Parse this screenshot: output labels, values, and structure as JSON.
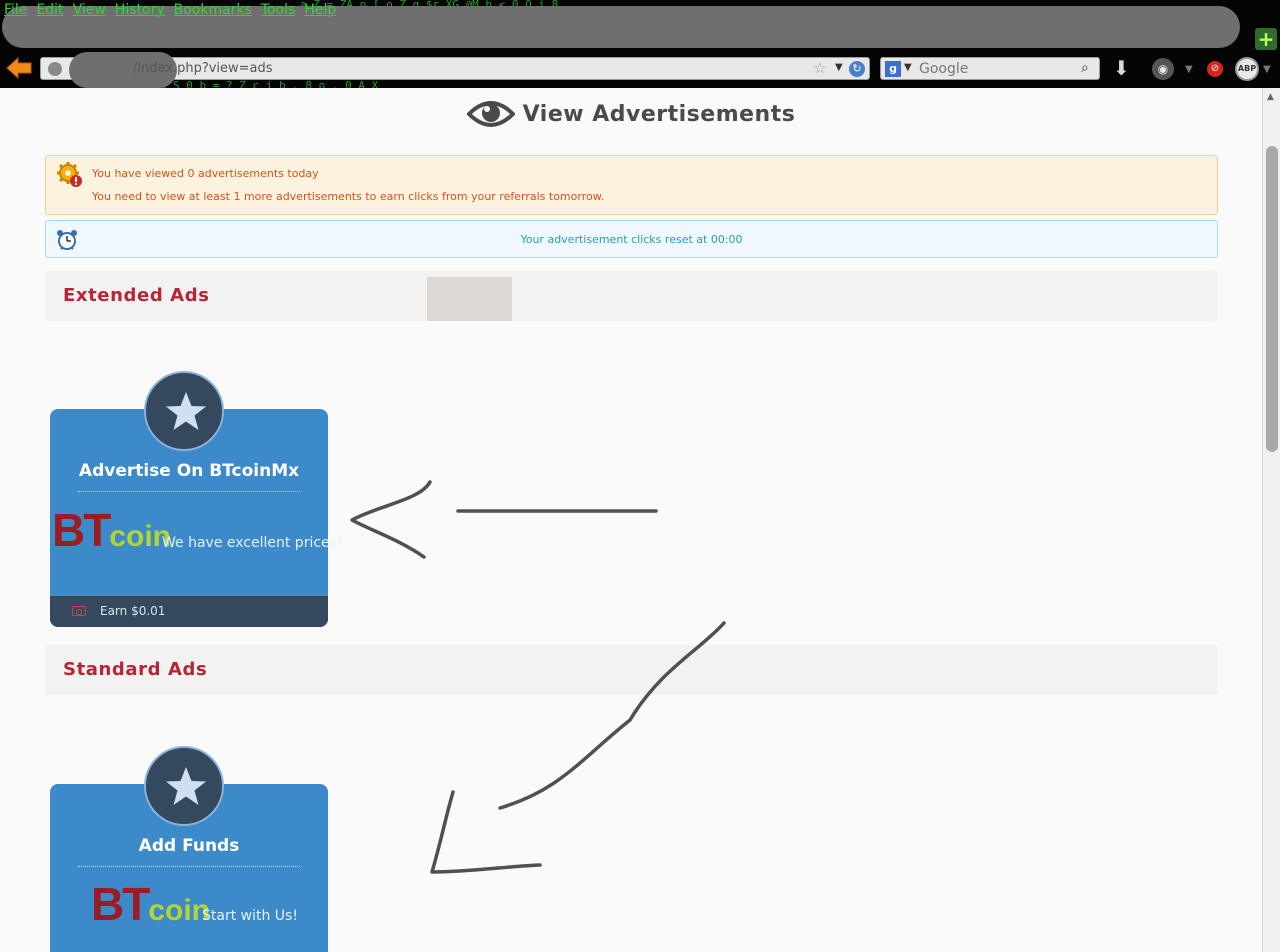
{
  "browser": {
    "menu": [
      "File",
      "Edit",
      "View",
      "History",
      "Bookmarks",
      "Tools",
      "Help"
    ],
    "url": "/index.php?view=ads",
    "search_engine": "Google",
    "search_placeholder": "Google",
    "abp_label": "ABP"
  },
  "page": {
    "title": "View Advertisements",
    "warning": {
      "line1": "You have viewed 0 advertisements today",
      "line2": "You need to view at least 1 more advertisements to earn clicks from your referrals tomorrow."
    },
    "info": {
      "text": "Your advertisement clicks reset at 00:00"
    }
  },
  "sections": {
    "extended": {
      "title": "Extended Ads",
      "ads": [
        {
          "title": "Advertise On BTcoinMx",
          "logo_bt": "BT",
          "logo_coin": "coin",
          "description": "We have excellent prices!",
          "earn": "Earn $0.01"
        }
      ]
    },
    "standard": {
      "title": "Standard Ads",
      "ads": [
        {
          "title": "Add Funds",
          "logo_bt": "BT",
          "logo_coin": "coin",
          "description": "Start with Us!"
        }
      ]
    }
  },
  "colors": {
    "section_title": "#b72535",
    "card_bg": "#3d8acb",
    "card_dark": "#34495e",
    "warning_text": "#d2541c",
    "info_text": "#2a9bc2"
  }
}
